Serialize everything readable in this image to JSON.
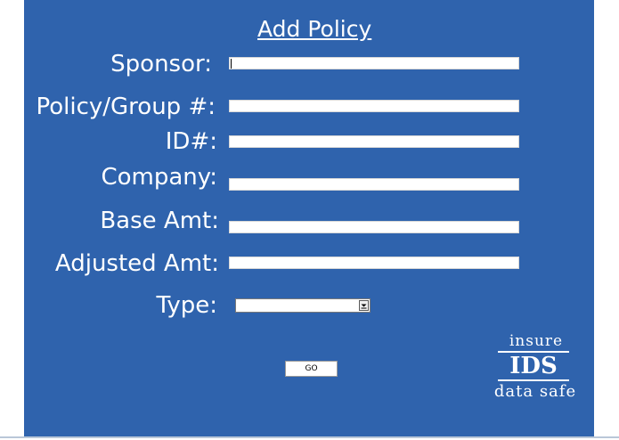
{
  "form": {
    "title": "Add Policy",
    "fields": {
      "sponsor": {
        "label": "Sponsor:",
        "value": ""
      },
      "policy_group": {
        "label": "Policy/Group #:",
        "value": ""
      },
      "id": {
        "label": "ID#:",
        "value": ""
      },
      "company": {
        "label": "Company:",
        "value": ""
      },
      "base_amt": {
        "label": "Base Amt:",
        "value": ""
      },
      "adjusted_amt": {
        "label": "Adjusted Amt:",
        "value": ""
      },
      "type": {
        "label": "Type:",
        "value": ""
      }
    },
    "go_label": "GO"
  },
  "logo": {
    "top_text": "insure",
    "mark_text": "IDS",
    "bottom_text": "data safe"
  },
  "colors": {
    "panel_background": "#2f63ad",
    "text": "#ffffff"
  },
  "icons": {
    "dropdown": "chevron-down-icon"
  }
}
